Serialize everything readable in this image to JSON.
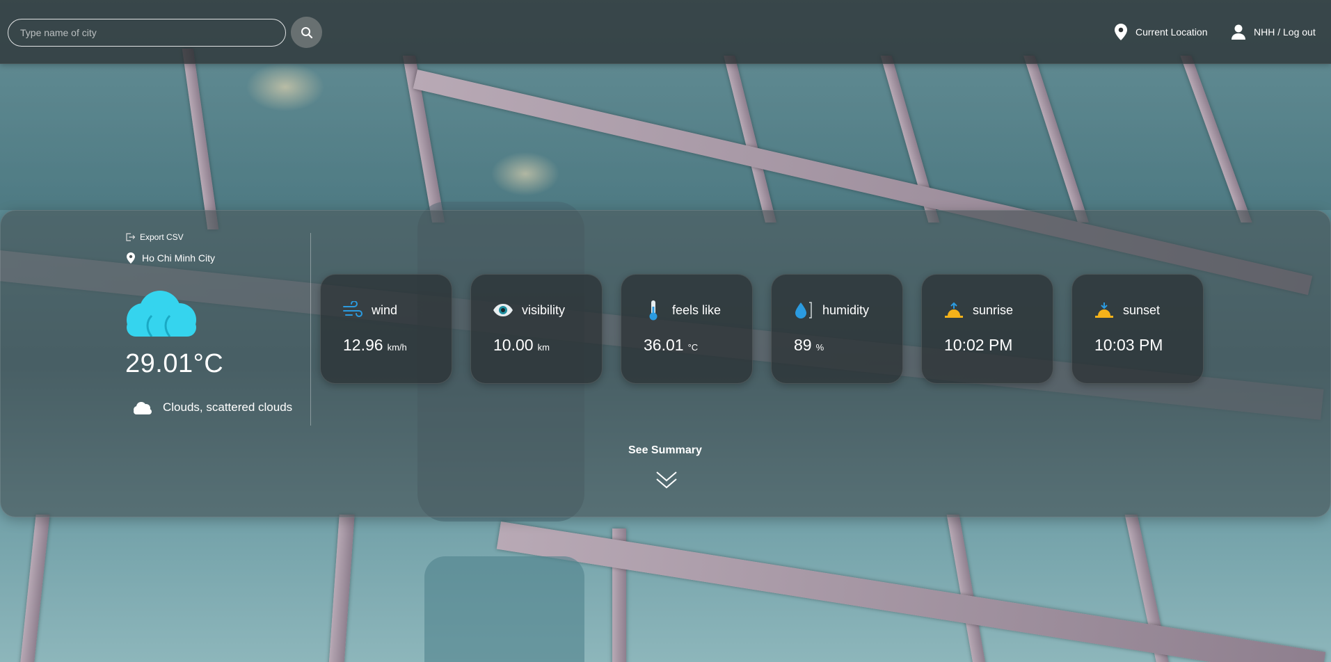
{
  "search": {
    "placeholder": "Type name of city"
  },
  "header": {
    "current_location": "Current Location",
    "user": "NHH / Log out"
  },
  "current": {
    "export_label": "Export CSV",
    "city": "Ho Chi Minh City",
    "temperature": "29.01°C",
    "description": "Clouds, scattered clouds"
  },
  "cards": [
    {
      "icon": "wind-icon",
      "label": "wind",
      "value": "12.96",
      "unit": "km/h"
    },
    {
      "icon": "eye-icon",
      "label": "visibility",
      "value": "10.00",
      "unit": "km"
    },
    {
      "icon": "thermometer-icon",
      "label": "feels like",
      "value": "36.01",
      "unit": "°C"
    },
    {
      "icon": "humidity-icon",
      "label": "humidity",
      "value": "89",
      "unit": "%"
    },
    {
      "icon": "sunrise-icon",
      "label": "sunrise",
      "value": "10:02 PM",
      "unit": ""
    },
    {
      "icon": "sunset-icon",
      "label": "sunset",
      "value": "10:03 PM",
      "unit": ""
    }
  ],
  "summary": {
    "label": "See Summary"
  },
  "colors": {
    "accent_cloud": "#35d4ee",
    "panel": "#464f53",
    "icon_blue": "#2b9be0",
    "sun_yellow": "#f5b21a"
  }
}
